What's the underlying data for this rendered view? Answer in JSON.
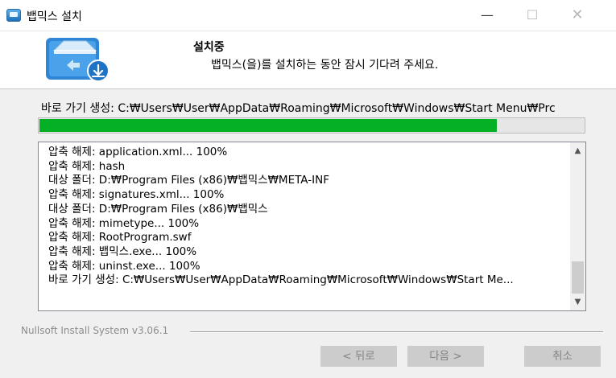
{
  "window": {
    "title": "뱁믹스 설치",
    "controls": {
      "minimize": "—",
      "maximize": "☐",
      "close": "✕"
    }
  },
  "header": {
    "icon": "installer-icon",
    "title": "설치중",
    "subtitle": "뱁믹스(을)를 설치하는 동안 잠시 기다려 주세요."
  },
  "status_line": "바로 가기 생성: C:₩Users₩User₩AppData₩Roaming₩Microsoft₩Windows₩Start Menu₩Prc",
  "progress": {
    "fraction": 0.84,
    "color": "#06b025"
  },
  "log": {
    "items": [
      "압축 해제: application.xml... 100%",
      "압축 해제: hash",
      "대상 폴더: D:₩Program Files (x86)₩뱁믹스₩META-INF",
      "압축 해제: signatures.xml... 100%",
      "대상 폴더: D:₩Program Files (x86)₩뱁믹스",
      "압축 해제: mimetype... 100%",
      "압축 해제: RootProgram.swf",
      "압축 해제: 뱁믹스.exe... 100%",
      "압축 해제: uninst.exe... 100%",
      "바로 가기 생성: C:₩Users₩User₩AppData₩Roaming₩Microsoft₩Windows₩Start Me..."
    ]
  },
  "footer": {
    "branding": "Nullsoft Install System v3.06.1",
    "buttons": {
      "back": "< 뒤로",
      "next": "다음 >",
      "cancel": "취소"
    }
  }
}
